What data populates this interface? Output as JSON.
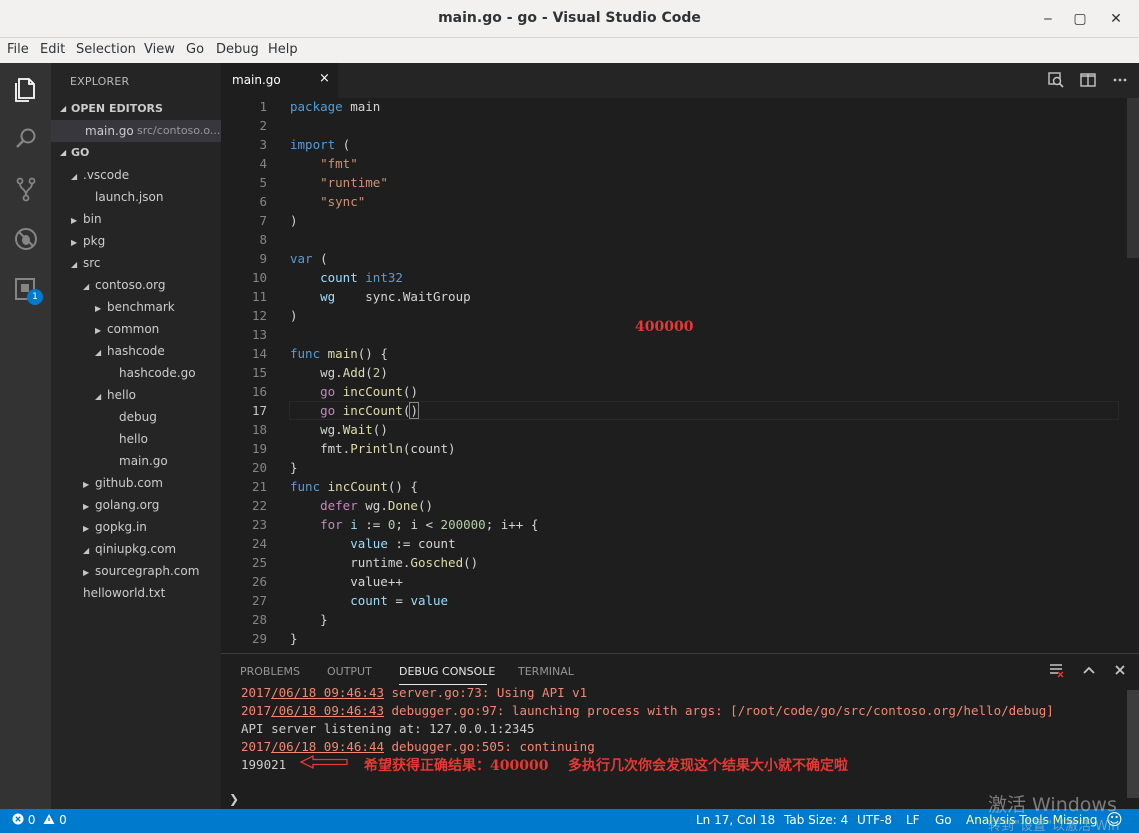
{
  "window": {
    "title": "main.go - go - Visual Studio Code",
    "minimize": "‒",
    "maximize": "▢",
    "close": "✕"
  },
  "menu": [
    "File",
    "Edit",
    "Selection",
    "View",
    "Go",
    "Debug",
    "Help"
  ],
  "activity": {
    "extensions_badge": "1"
  },
  "sidebar": {
    "title": "EXPLORER",
    "open_editors_header": "OPEN EDITORS",
    "open_editor": {
      "name": "main.go",
      "path": "src/contoso.o..."
    },
    "workspace_header": "GO",
    "tree": [
      {
        "label": ".vscode",
        "twisty": "◢",
        "depth": 1
      },
      {
        "label": "launch.json",
        "twisty": "",
        "depth": 2
      },
      {
        "label": "bin",
        "twisty": "▶",
        "depth": 1
      },
      {
        "label": "pkg",
        "twisty": "▶",
        "depth": 1
      },
      {
        "label": "src",
        "twisty": "◢",
        "depth": 1
      },
      {
        "label": "contoso.org",
        "twisty": "◢",
        "depth": 2
      },
      {
        "label": "benchmark",
        "twisty": "▶",
        "depth": 3
      },
      {
        "label": "common",
        "twisty": "▶",
        "depth": 3
      },
      {
        "label": "hashcode",
        "twisty": "◢",
        "depth": 3
      },
      {
        "label": "hashcode.go",
        "twisty": "",
        "depth": 4
      },
      {
        "label": "hello",
        "twisty": "◢",
        "depth": 3
      },
      {
        "label": "debug",
        "twisty": "",
        "depth": 4
      },
      {
        "label": "hello",
        "twisty": "",
        "depth": 4
      },
      {
        "label": "main.go",
        "twisty": "",
        "depth": 4
      },
      {
        "label": "github.com",
        "twisty": "▶",
        "depth": 2
      },
      {
        "label": "golang.org",
        "twisty": "▶",
        "depth": 2
      },
      {
        "label": "gopkg.in",
        "twisty": "▶",
        "depth": 2
      },
      {
        "label": "qiniupkg.com",
        "twisty": "◢",
        "depth": 2
      },
      {
        "label": "sourcegraph.com",
        "twisty": "▶",
        "depth": 2
      },
      {
        "label": "helloworld.txt",
        "twisty": "",
        "depth": 1
      }
    ]
  },
  "editor": {
    "tab_name": "main.go",
    "tab_close": "×",
    "line_numbers": [
      "1",
      "2",
      "3",
      "4",
      "5",
      "6",
      "7",
      "8",
      "9",
      "10",
      "11",
      "12",
      "13",
      "14",
      "15",
      "16",
      "17",
      "18",
      "19",
      "20",
      "21",
      "22",
      "23",
      "24",
      "25",
      "26",
      "27",
      "28",
      "29"
    ],
    "annotation": "400000"
  },
  "panel": {
    "tabs": [
      "PROBLEMS",
      "OUTPUT",
      "DEBUG CONSOLE",
      "TERMINAL"
    ],
    "console": {
      "l1_a": "2017",
      "l1_b": "/06/18 09:46:43",
      "l1_c": " server.go:73: Using API v1",
      "l2_a": "2017",
      "l2_b": "/06/18 09:46:43",
      "l2_c": " debugger.go:97: launching process with args: [/root/code/go/src/contoso.org/hello/debug]",
      "l3": "API server listening at: 127.0.0.1:2345",
      "l4_a": "2017",
      "l4_b": "/06/18 09:46:44",
      "l4_c": " debugger.go:505: continuing",
      "l5": "199021"
    },
    "annotation": "希望获得正确结果：400000    多执行几次你会发现这个结果大小就不确定啦",
    "prompt": "❯"
  },
  "status": {
    "errors": "0",
    "warnings": "0",
    "position": "Ln 17, Col 18",
    "tab_size": "Tab Size: 4",
    "encoding": "UTF-8",
    "eol": "LF",
    "language": "Go",
    "analysis": "Analysis Tools Missing",
    "smiley": "☺"
  },
  "watermark": {
    "line1": "激活 Windows",
    "line2": "转到\"设置\"以激活 Win"
  }
}
